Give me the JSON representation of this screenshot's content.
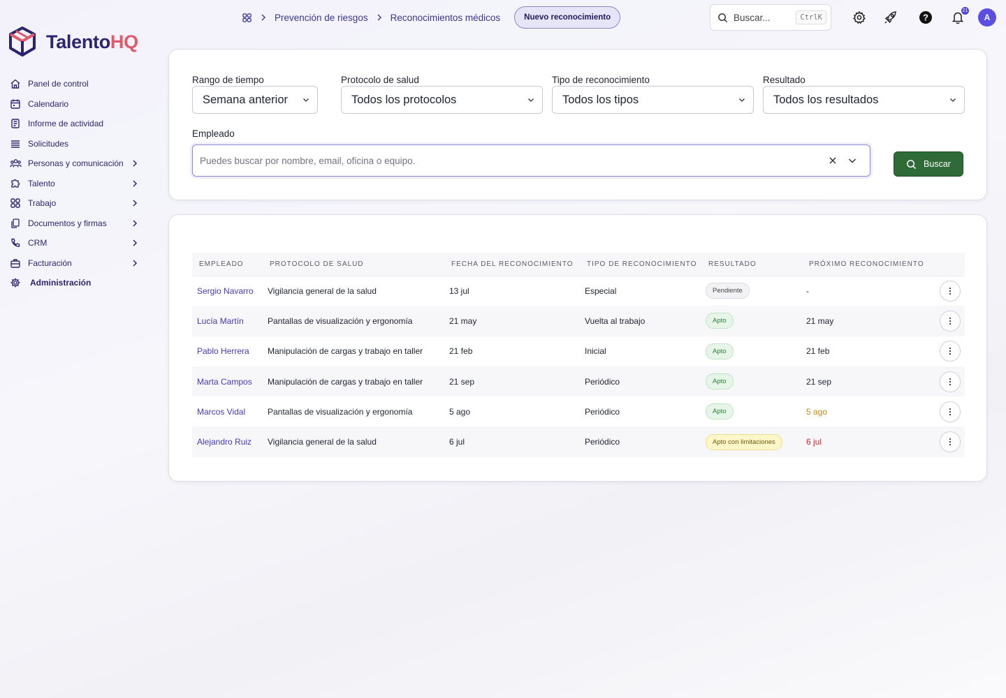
{
  "brand": {
    "name_main": "Talento",
    "name_accent": "HQ",
    "accent_color": "#e05a6c",
    "primary_color": "#2b2470"
  },
  "sidebar": {
    "items": [
      {
        "label": "Panel de control",
        "icon": "home-icon",
        "has_children": false
      },
      {
        "label": "Calendario",
        "icon": "calendar-icon",
        "has_children": false
      },
      {
        "label": "Informe de actividad",
        "icon": "report-icon",
        "has_children": false
      },
      {
        "label": "Solicitudes",
        "icon": "list-icon",
        "has_children": false
      },
      {
        "label": "Personas y comunicación",
        "icon": "people-icon",
        "has_children": true
      },
      {
        "label": "Talento",
        "icon": "puzzle-icon",
        "has_children": true
      },
      {
        "label": "Trabajo",
        "icon": "grid-icon",
        "has_children": true
      },
      {
        "label": "Documentos y firmas",
        "icon": "documents-icon",
        "has_children": true
      },
      {
        "label": "CRM",
        "icon": "phone-icon",
        "has_children": true
      },
      {
        "label": "Facturación",
        "icon": "briefcase-icon",
        "has_children": true
      },
      {
        "label": "Administración",
        "icon": "gear-icon",
        "has_children": false
      }
    ]
  },
  "header": {
    "breadcrumb": [
      "Prevención de riesgos",
      "Reconocimientos médicos"
    ],
    "new_button": "Nuevo reconocimiento",
    "search_placeholder": "Buscar...",
    "search_shortcut": "CtrlK",
    "notification_count": "21",
    "avatar_initial": "A"
  },
  "filters": {
    "time_range": {
      "label": "Rango de tiempo",
      "value": "Semana anterior"
    },
    "protocol": {
      "label": "Protocolo de salud",
      "value": "Todos los protocolos"
    },
    "type": {
      "label": "Tipo de reconocimiento",
      "value": "Todos los tipos"
    },
    "result": {
      "label": "Resultado",
      "value": "Todos los resultados"
    },
    "employee": {
      "label": "Empleado",
      "placeholder": "Puedes buscar por nombre, email, oficina o equipo.",
      "value": ""
    },
    "search_button": "Buscar"
  },
  "table": {
    "columns": [
      "Empleado",
      "Protocolo de salud",
      "Fecha del reconocimiento",
      "Tipo de reconocimiento",
      "Resultado",
      "Próximo reconocimiento"
    ],
    "rows": [
      {
        "employee": "Sergio Navarro",
        "protocol": "Vigilancia general de la salud",
        "date": "13 jul",
        "type": "Especial",
        "result": "Pendiente",
        "result_kind": "pend",
        "next": "-",
        "next_kind": ""
      },
      {
        "employee": "Lucía Martín",
        "protocol": "Pantallas de visualización y ergonomía",
        "date": "21 may",
        "type": "Vuelta al trabajo",
        "result": "Apto",
        "result_kind": "apto",
        "next": "21 may",
        "next_kind": ""
      },
      {
        "employee": "Pablo Herrera",
        "protocol": "Manipulación de cargas y trabajo en taller",
        "date": "21 feb",
        "type": "Inicial",
        "result": "Apto",
        "result_kind": "apto",
        "next": "21 feb",
        "next_kind": ""
      },
      {
        "employee": "Marta Campos",
        "protocol": "Manipulación de cargas y trabajo en taller",
        "date": "21 sep",
        "type": "Periódico",
        "result": "Apto",
        "result_kind": "apto",
        "next": "21 sep",
        "next_kind": ""
      },
      {
        "employee": "Marcos Vidal",
        "protocol": "Pantallas de visualización y ergonomía",
        "date": "5 ago",
        "type": "Periódico",
        "result": "Apto",
        "result_kind": "apto",
        "next": "5 ago",
        "next_kind": "warn"
      },
      {
        "employee": "Alejandro Ruiz",
        "protocol": "Vigilancia general de la salud",
        "date": "6 jul",
        "type": "Periódico",
        "result": "Apto con limitaciones",
        "result_kind": "lim",
        "next": "6 jul",
        "next_kind": "late"
      }
    ]
  }
}
